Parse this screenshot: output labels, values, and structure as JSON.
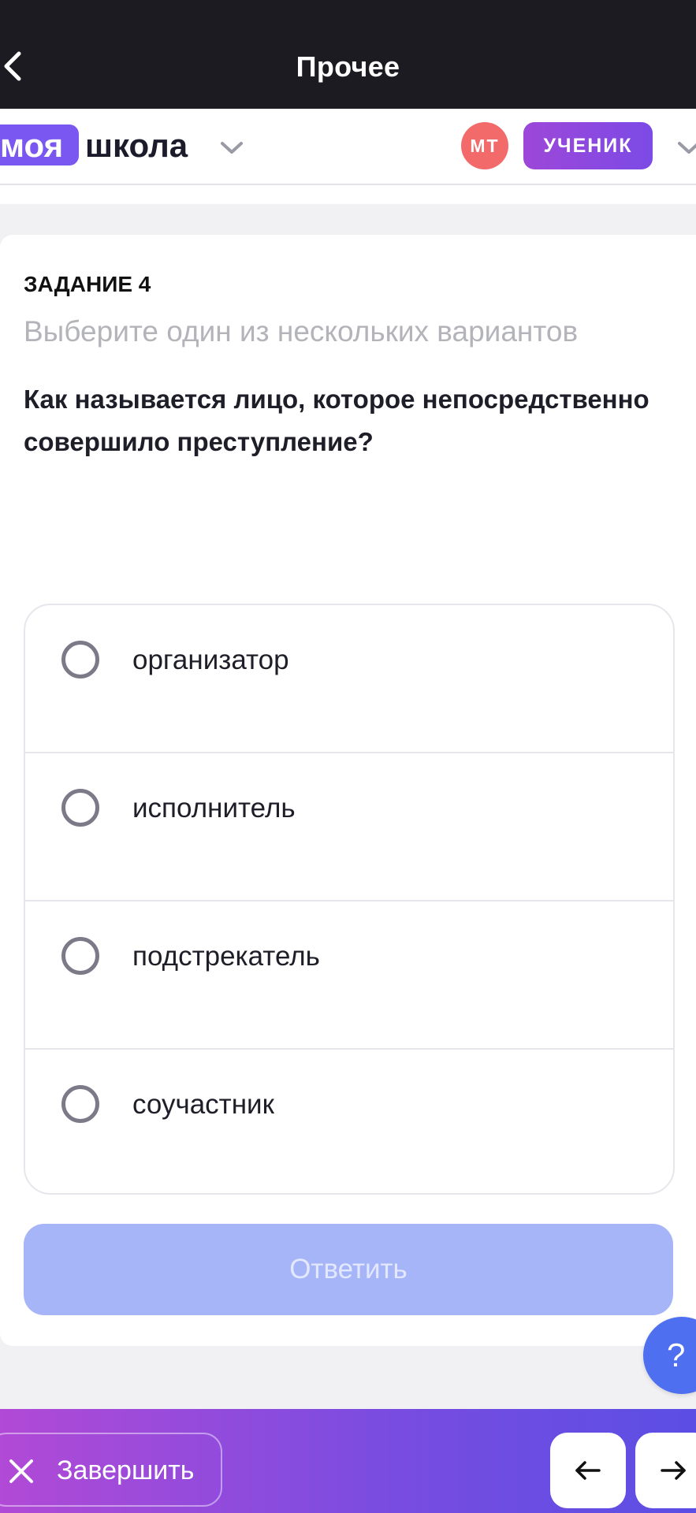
{
  "topbar": {
    "title": "Прочее",
    "back_icon": "chevron-left-icon"
  },
  "app_header": {
    "logo_part1": "моя",
    "logo_part2": "школа",
    "avatar_initials": "МТ",
    "role": "УЧЕНИК"
  },
  "task": {
    "number": "ЗАДАНИЕ 4",
    "hint": "Выберите один из нескольких вариантов",
    "question": "Как называется лицо, которое непосредственно совершило преступление?",
    "options": [
      {
        "label": "организатор"
      },
      {
        "label": "исполнитель"
      },
      {
        "label": "подстрекатель"
      },
      {
        "label": "соучастник"
      }
    ],
    "submit_label": "Ответить"
  },
  "help": {
    "label": "?"
  },
  "bottom_bar": {
    "finish_label": "Завершить"
  },
  "colors": {
    "topbar_bg": "#1c1b21",
    "brand_purple": "#7a57f0",
    "avatar_red": "#f26a6a",
    "submit_disabled": "#a6b5f8",
    "help_blue": "#4d6ff0"
  }
}
